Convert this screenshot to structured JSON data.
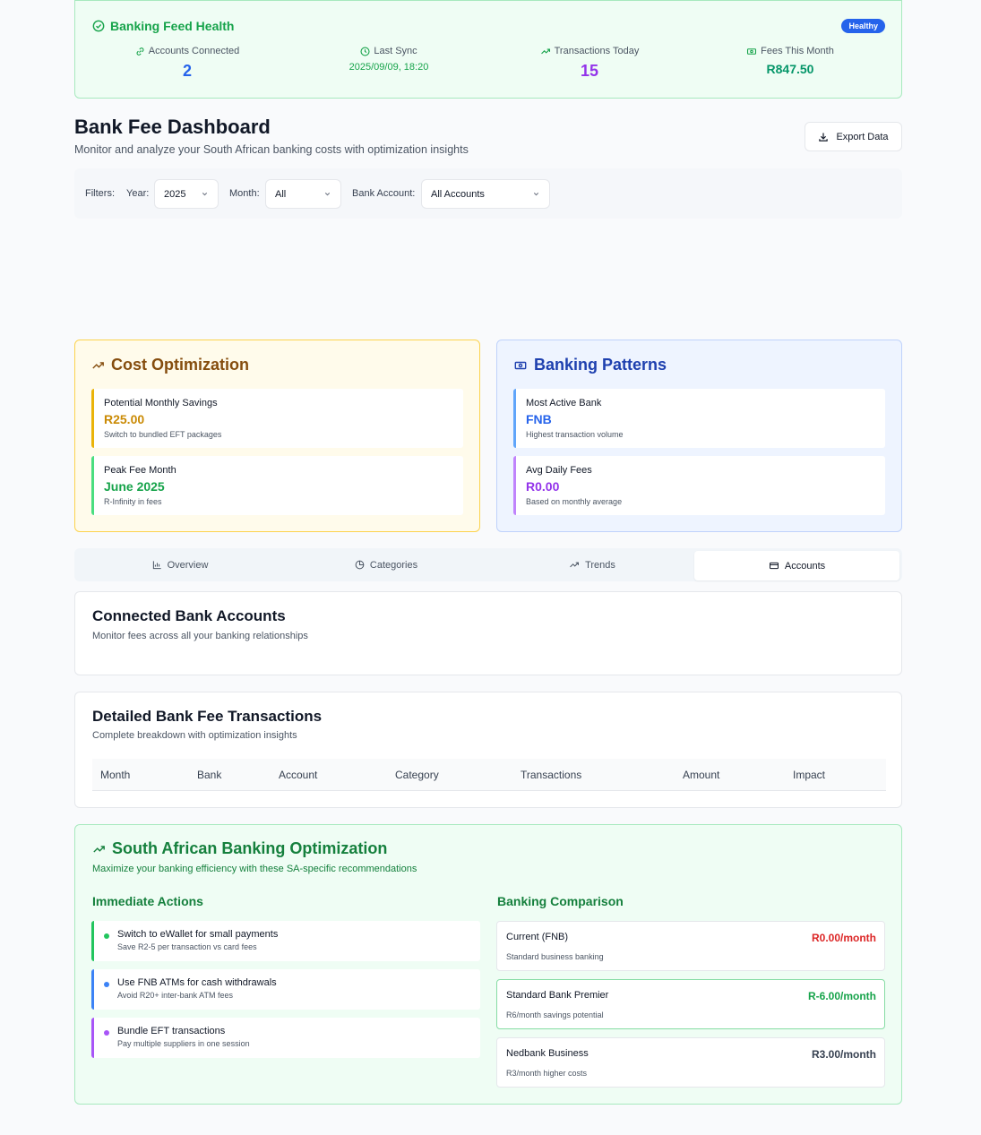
{
  "health": {
    "title": "Banking Feed Health",
    "badge": "Healthy",
    "stats": [
      {
        "label": "Accounts Connected",
        "value": "2",
        "icon": "link-icon",
        "color": "#2563eb"
      },
      {
        "label": "Last Sync",
        "value": "2025/09/09, 18:20",
        "icon": "clock-icon",
        "color": "#16a34a"
      },
      {
        "label": "Transactions Today",
        "value": "15",
        "icon": "trending-up-icon",
        "color": "#9333ea"
      },
      {
        "label": "Fees This Month",
        "value": "R847.50",
        "icon": "banknote-icon",
        "color": "#059669"
      }
    ]
  },
  "header": {
    "title": "Bank Fee Dashboard",
    "subtitle": "Monitor and analyze your South African banking costs with optimization insights",
    "export_label": "Export Data"
  },
  "filters": {
    "label": "Filters:",
    "year_label": "Year:",
    "year_value": "2025",
    "month_label": "Month:",
    "month_value": "All",
    "account_label": "Bank Account:",
    "account_value": "All Accounts"
  },
  "cost_optimization": {
    "title": "Cost Optimization",
    "metrics": [
      {
        "label": "Potential Monthly Savings",
        "value": "R25.00",
        "note": "Switch to bundled EFT packages",
        "color": "#ca8a04",
        "border": "#eab308"
      },
      {
        "label": "Peak Fee Month",
        "value": "June 2025",
        "note": "R-Infinity in fees",
        "color": "#16a34a",
        "border": "#4ade80"
      }
    ]
  },
  "banking_patterns": {
    "title": "Banking Patterns",
    "metrics": [
      {
        "label": "Most Active Bank",
        "value": "FNB",
        "note": "Highest transaction volume",
        "color": "#2563eb",
        "border": "#60a5fa"
      },
      {
        "label": "Avg Daily Fees",
        "value": "R0.00",
        "note": "Based on monthly average",
        "color": "#9333ea",
        "border": "#c084fc"
      }
    ]
  },
  "tabs": [
    {
      "label": "Overview",
      "icon": "bar-chart-icon"
    },
    {
      "label": "Categories",
      "icon": "pie-chart-icon"
    },
    {
      "label": "Trends",
      "icon": "trending-up-icon"
    },
    {
      "label": "Accounts",
      "icon": "credit-card-icon",
      "active": true
    }
  ],
  "accounts_panel": {
    "title": "Connected Bank Accounts",
    "subtitle": "Monitor fees across all your banking relationships"
  },
  "transactions_panel": {
    "title": "Detailed Bank Fee Transactions",
    "subtitle": "Complete breakdown with optimization insights",
    "columns": [
      "Month",
      "Bank",
      "Account",
      "Category",
      "Transactions",
      "Amount",
      "Impact"
    ]
  },
  "optimization": {
    "title": "South African Banking Optimization",
    "subtitle": "Maximize your banking efficiency with these SA-specific recommendations",
    "actions_title": "Immediate Actions",
    "actions": [
      {
        "title": "Switch to eWallet for small payments",
        "note": "Save R2-5 per transaction vs card fees",
        "color": "#22c55e"
      },
      {
        "title": "Use FNB ATMs for cash withdrawals",
        "note": "Avoid R20+ inter-bank ATM fees",
        "color": "#3b82f6"
      },
      {
        "title": "Bundle EFT transactions",
        "note": "Pay multiple suppliers in one session",
        "color": "#a855f7"
      }
    ],
    "comparison_title": "Banking Comparison",
    "comparison": [
      {
        "name": "Current (FNB)",
        "note": "Standard business banking",
        "price": "R0.00/month",
        "color": "#dc2626"
      },
      {
        "name": "Standard Bank Premier",
        "note": "R6/month savings potential",
        "price": "R-6.00/month",
        "color": "#16a34a"
      },
      {
        "name": "Nedbank Business",
        "note": "R3/month higher costs",
        "price": "R3.00/month",
        "color": "#374151"
      }
    ]
  }
}
